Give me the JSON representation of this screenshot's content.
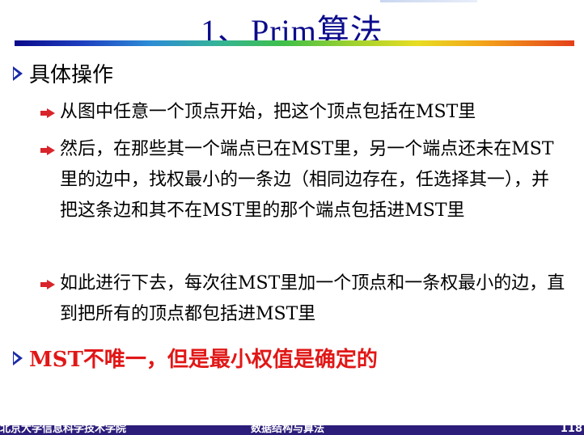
{
  "slide": {
    "title": "1、Prim算法",
    "bullet1": "具体操作",
    "sub1": "从图中任意一个顶点开始，把这个顶点包括在MST里",
    "sub2": "然后，在那些其一个端点已在MST里，另一个端点还未在MST里的边中，找权最小的一条边（相同边存在，任选择其一），并把这条边和其不在MST里的那个端点包括进MST里",
    "sub3": "如此进行下去，每次往MST里加一个顶点和一条权最小的边，直到把所有的顶点都包括进MST里",
    "bullet2": "MST不唯一，但是最小权值是确定的"
  },
  "footer": {
    "school": "北京大学信息科学技术学院",
    "course": "数据结构与算法",
    "page": "118"
  },
  "colors": {
    "title": "#0b0b8c",
    "highlight": "#e11717",
    "bullet_arrow": "#d8242a",
    "footer_bg": "#2c1d7a"
  }
}
